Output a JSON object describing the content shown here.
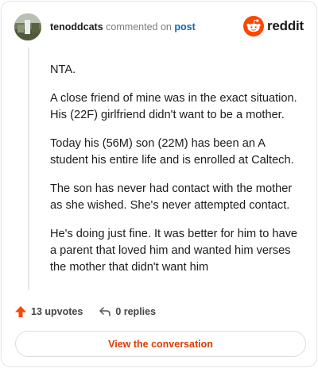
{
  "comment": {
    "username": "tenoddcats",
    "verb": "commented on",
    "post_link": "post",
    "paragraphs": [
      "NTA.",
      "A close friend of mine was in the exact situation. His (22F) girlfriend didn't want to be a mother.",
      "Today his (56M) son (22M) has been an A student his entire life and is enrolled at Caltech.",
      "The son has never had contact with the mother as she wished. She's never attempted contact.",
      "He's doing just fine. It was better for him to have a parent that loved him and wanted him verses the mother that didn't want him"
    ],
    "upvotes": "13 upvotes",
    "replies": "0 replies"
  },
  "brand": {
    "name": "reddit",
    "color": "#ff4500"
  },
  "cta": {
    "label": "View the conversation"
  },
  "icons": {
    "upvote": "upvote-arrow-icon",
    "reply": "reply-arrow-icon",
    "logo": "reddit-snoo-icon"
  }
}
